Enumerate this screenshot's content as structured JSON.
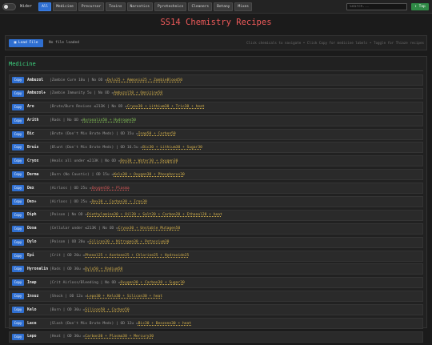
{
  "nav": {
    "toggle_label": "Wider",
    "tabs": [
      "All",
      "Medicine",
      "Precursor",
      "Toxins",
      "Narcotics",
      "Pyrotechnics",
      "Cleaners",
      "Botany",
      "Mixes"
    ],
    "active_tab": "All",
    "search_placeholder": "Search...",
    "top_button": "↑ Top"
  },
  "title": "SS14 Chemistry Recipes",
  "load": {
    "button": "Load File",
    "status": "No file loaded",
    "hint": "Click chemicals to navigate • Click Copy for medicine labels • Toggle for Thiaze recipes"
  },
  "section": {
    "title": "Medicine",
    "copy_label": "Copy",
    "rows": [
      {
        "name": "Ambuzol",
        "desc": "Zombie Cure 10u | No OD =",
        "recipe": "Dylo25 + Ammonia25 + ZombieBlood50",
        "color": "y"
      },
      {
        "name": "Ambuzol+",
        "desc": "Zombie Immunity 5u | No OD =",
        "recipe": "Ambuzol50 + Omnizine50",
        "color": "y"
      },
      {
        "name": "Aro",
        "desc": "Brute/Burn Revives ≤213K | No OD =",
        "recipe": "Cryox30 + Lithium30 + Tric30 + heat",
        "color": "y"
      },
      {
        "name": "Arith",
        "desc": "Rads | No OD =",
        "recipe": "Hyronalin50 + Hydrogen50",
        "color": "g"
      },
      {
        "name": "Bic",
        "desc": "Brute (Don't Mix Brute Meds) | OD 15u =",
        "recipe": "Inap50 + Carbon50",
        "color": "y"
      },
      {
        "name": "Bruis",
        "desc": "Blunt (Don't Mix Brute Meds) | OD 16.5u =",
        "recipe": "Bic30 + Lithium30 + Sugar30",
        "color": "y"
      },
      {
        "name": "Cryox",
        "desc": "Heals all under ≤213K | No OD =",
        "recipe": "Dex30 + Water30 + Oxygen30",
        "color": "y"
      },
      {
        "name": "Derma",
        "desc": "Burn (No Caustic) | OD 15u =",
        "recipe": "Kelo30 + Oxygen30 + Phosphorus30",
        "color": "y"
      },
      {
        "name": "Dex",
        "desc": "Airloss | OD 25u =",
        "recipe": "Oxygen50 + Plasma",
        "color": "r"
      },
      {
        "name": "Dex+",
        "desc": "Airloss | OD 25u =",
        "recipe": "Dex30 + Carbon30 + Iron30",
        "color": "y"
      },
      {
        "name": "Diph",
        "desc": "Poison | No OD =",
        "recipe": "Diethylamine30 + Oil20 + Salt20 + Carbon20 + Ethanol20 + heat",
        "color": "y"
      },
      {
        "name": "Dosa",
        "desc": "Cellular under ≤213K | No OD =",
        "recipe": "Cryox30 + Unstable Mutagen50",
        "color": "y"
      },
      {
        "name": "Dylo",
        "desc": "Poison | OD 20u =",
        "recipe": "Silicon30 + Nitrogen30 + Potassium30",
        "color": "y"
      },
      {
        "name": "Epi",
        "desc": "Crit | OD 20u =",
        "recipe": "Phenol25 + Acetone25 + Chlorine25 + Hydroxide25",
        "color": "y"
      },
      {
        "name": "Hyronalin",
        "desc": "Rads | OD 30u =",
        "recipe": "Dylo50 + Radium50",
        "color": "y"
      },
      {
        "name": "Inap",
        "desc": "Crit Airloss/Bleeding | No OD =",
        "recipe": "Oxygen30 + Carbon30 + Sugar30",
        "color": "y"
      },
      {
        "name": "Insuz",
        "desc": "Shock | OD 12u =",
        "recipe": "Lepo30 + Kelo30 + Silicon30 + heat",
        "color": "y"
      },
      {
        "name": "Kelo",
        "desc": "Burn | OD 30u =",
        "recipe": "Silicon50 + Carbon50",
        "color": "y"
      },
      {
        "name": "Lace",
        "desc": "Slash (Don't Mix Brute Meds) | OD 12u =",
        "recipe": "Bic30 + Benzene30 + heat",
        "color": "y"
      },
      {
        "name": "Lepo",
        "desc": "Heat | OD 30u =",
        "recipe": "Carbon30 + Plasma30 + Mercury30",
        "color": "y"
      }
    ]
  }
}
